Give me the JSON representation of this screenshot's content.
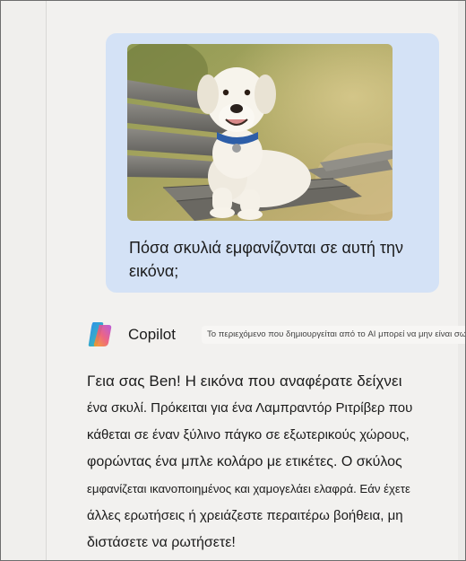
{
  "user_message": {
    "image_icon": "photo-of-dog-on-bench",
    "text": "Πόσα σκυλιά εμφανίζονται σε αυτή την εικόνα;"
  },
  "copilot": {
    "name": "Copilot",
    "logo_icon": "copilot-logo-icon",
    "disclaimer": "Το περιεχόμενο που δημιουργείται από το AI μπορεί να μην είναι σωστό"
  },
  "response": {
    "lines": [
      "Γεια σας Ben! Η εικόνα που αναφέρατε δείχνει",
      "ένα σκυλί. Πρόκειται για ένα Λαμπραντόρ Ριτρίβερ που",
      "κάθεται σε έναν ξύλινο πάγκο σε εξωτερικούς χώρους,",
      "φορώντας ένα μπλε κολάρο με ετικέτες. Ο σκύλος",
      "εμφανίζεται ικανοποιημένος και χαμογελάει ελαφρά. Εάν έχετε",
      "άλλες ερωτήσεις ή χρειάζεστε περαιτέρω βοήθεια, μη",
      "διστάσετε να ρωτήσετε!"
    ]
  },
  "colors": {
    "user_bubble": "#d4e2f6",
    "background": "#f2f1ef",
    "text": "#1b1b1b"
  }
}
